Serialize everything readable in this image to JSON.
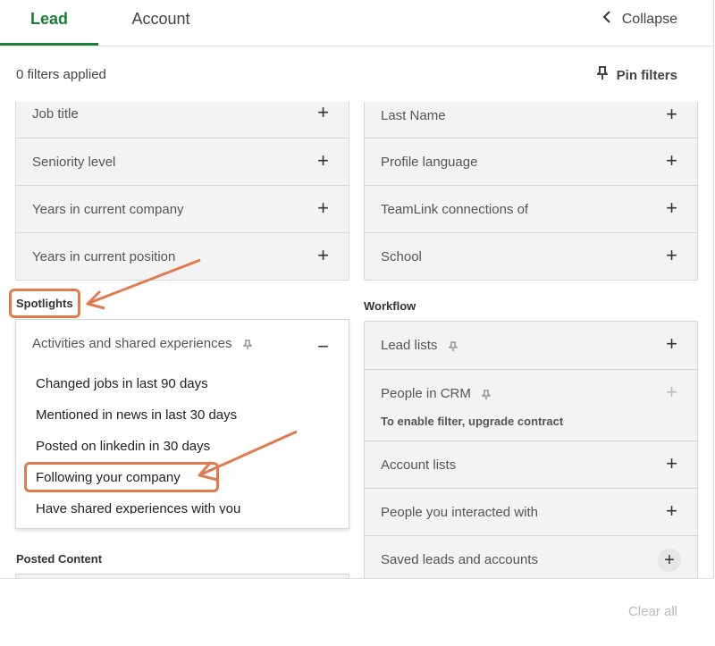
{
  "tabs": [
    {
      "label": "Lead",
      "active": true
    },
    {
      "label": "Account",
      "active": false
    }
  ],
  "collapse_label": "Collapse",
  "filters_applied": "0 filters applied",
  "pin_filters_label": "Pin filters",
  "left_top_rows": [
    "Job title",
    "Seniority level",
    "Years in current company",
    "Years in current position"
  ],
  "right_top_rows": [
    "Last Name",
    "Profile language",
    "TeamLink connections of",
    "School"
  ],
  "spotlights": {
    "title": "Spotlights",
    "group_label": "Activities and shared experiences",
    "options": [
      "Changed jobs in last 90 days",
      "Mentioned in news in last 30 days",
      "Posted on linkedin in 30 days",
      "Following your company",
      "Have shared experiences with you"
    ]
  },
  "workflow": {
    "title": "Workflow",
    "rows": [
      {
        "label": "Lead lists",
        "pinned": true
      },
      {
        "label": "People in CRM",
        "pinned": true,
        "note": "To enable filter, upgrade contract",
        "disabled": true
      },
      {
        "label": "Account lists"
      },
      {
        "label": "People you interacted with"
      },
      {
        "label": "Saved leads and accounts"
      }
    ]
  },
  "posted_content_title": "Posted Content",
  "clear_all_label": "Clear all",
  "colors": {
    "accent_green": "#1a7f37",
    "annotation_orange": "#e07b4f"
  }
}
